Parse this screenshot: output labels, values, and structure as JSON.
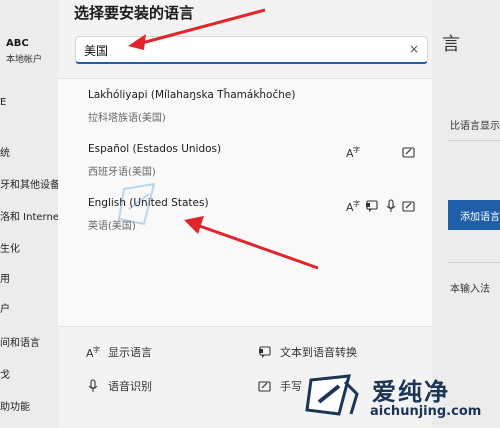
{
  "background": {
    "user_name": "ABC",
    "user_sub": "本地帐户",
    "nav": [
      {
        "label": "E",
        "selected": false
      },
      {
        "label": "统",
        "selected": false
      },
      {
        "label": "牙和其他设备",
        "selected": false
      },
      {
        "label": "洛和 Internet",
        "selected": false
      },
      {
        "label": "生化",
        "selected": false
      },
      {
        "label": "用",
        "selected": false
      },
      {
        "label": "⼾",
        "selected": false
      },
      {
        "label": "间和语言",
        "selected": true
      },
      {
        "label": "戈",
        "selected": false
      },
      {
        "label": "助功能",
        "selected": false
      }
    ],
    "right_text_1": "比语言显示",
    "right_button": "添加语言",
    "right_text_2": "本输入法",
    "right_heading": "言"
  },
  "dialog": {
    "title": "选择要安装的语言",
    "search_value": "美国",
    "search_clear": "×"
  },
  "languages": [
    {
      "name": "Lakȟóliyapi (Mílahaŋska Tȟamákȟočhe)",
      "native": "拉科塔族语(美国)",
      "features": []
    },
    {
      "name": "Español (Estados Unidos)",
      "native": "西班牙语(美国)",
      "features": [
        "display-language-icon",
        "handwriting-icon"
      ]
    },
    {
      "name": "English (United States)",
      "native": "英语(美国)",
      "features": [
        "display-language-icon",
        "text-to-speech-icon",
        "speech-recognition-icon",
        "handwriting-icon"
      ]
    }
  ],
  "features_legend": {
    "display_language": "显示语言",
    "text_to_speech": "文本到语音转换",
    "speech_recognition": "语音识别",
    "handwriting": "手写"
  },
  "watermark": {
    "text": "爱纯净",
    "url": "aichunjing.com"
  },
  "colors": {
    "accent": "#1f5fa8",
    "arrow": "#e0252b"
  }
}
